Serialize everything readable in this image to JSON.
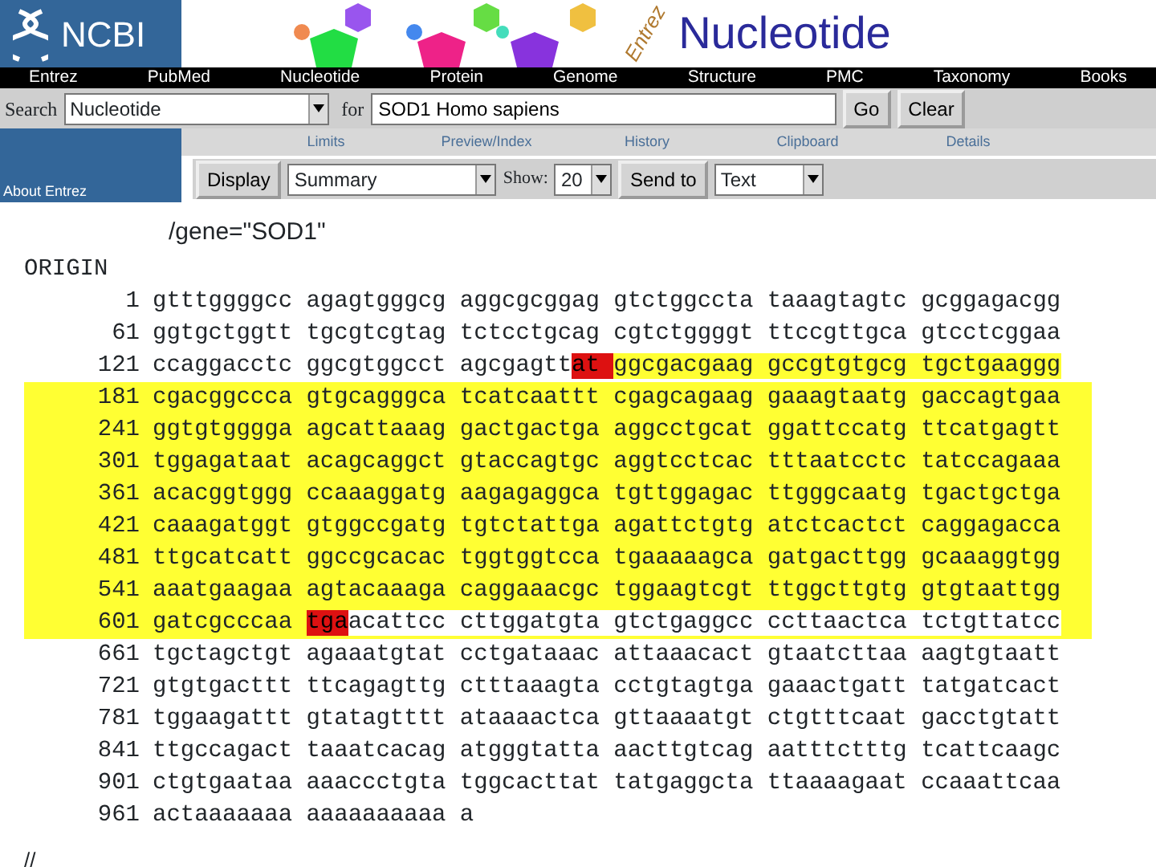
{
  "banner": {
    "org": "NCBI",
    "product_tag": "Entrez",
    "product": "Nucleotide"
  },
  "nav": [
    "Entrez",
    "PubMed",
    "Nucleotide",
    "Protein",
    "Genome",
    "Structure",
    "PMC",
    "Taxonomy",
    "Books"
  ],
  "search": {
    "label": "Search",
    "database": "Nucleotide",
    "for_label": "for",
    "query": "SOD1 Homo sapiens",
    "buttons": [
      "Go",
      "Clear"
    ]
  },
  "sidebar": {
    "link": "About Entrez"
  },
  "links": [
    "Limits",
    "Preview/Index",
    "History",
    "Clipboard",
    "Details"
  ],
  "display_bar": {
    "display_button": "Display",
    "format": "Summary",
    "show_label": "Show:",
    "count": "20",
    "send_button": "Send to",
    "destination": "Text"
  },
  "record": {
    "qualifier": "/gene=\"SOD1\"",
    "origin_label": "ORIGIN",
    "terminator": "//",
    "rows": [
      {
        "number": "1",
        "band": false,
        "segments": [
          {
            "kind": "plain",
            "text": "gtttggggcc agagtgggcg aggcgcggag gtctggccta taaagtagtc gcggagacgg"
          }
        ]
      },
      {
        "number": "61",
        "band": false,
        "segments": [
          {
            "kind": "plain",
            "text": "ggtgctggtt tgcgtcgtag tctcctgcag cgtctggggt ttccgttgca gtcctcggaa"
          }
        ]
      },
      {
        "number": "121",
        "band": false,
        "segments": [
          {
            "kind": "plain",
            "text": "ccaggacctc ggcgtggcct agcgagtt"
          },
          {
            "kind": "start",
            "text": "at "
          },
          {
            "kind": "cds",
            "text": "ggcgacgaag gccgtgtgcg tgctgaaggg"
          }
        ]
      },
      {
        "number": "181",
        "band": true,
        "segments": [
          {
            "kind": "cds",
            "text": "cgacggccca gtgcagggca tcatcaattt cgagcagaag gaaagtaatg gaccagtgaa"
          }
        ]
      },
      {
        "number": "241",
        "band": true,
        "segments": [
          {
            "kind": "cds",
            "text": "ggtgtgggga agcattaaag gactgactga aggcctgcat ggattccatg ttcatgagtt"
          }
        ]
      },
      {
        "number": "301",
        "band": true,
        "segments": [
          {
            "kind": "cds",
            "text": "tggagataat acagcaggct gtaccagtgc aggtcctcac tttaatcctc tatccagaaa"
          }
        ]
      },
      {
        "number": "361",
        "band": true,
        "segments": [
          {
            "kind": "cds",
            "text": "acacggtggg ccaaaggatg aagagaggca tgttggagac ttgggcaatg tgactgctga"
          }
        ]
      },
      {
        "number": "421",
        "band": true,
        "segments": [
          {
            "kind": "cds",
            "text": "caaagatggt gtggccgatg tgtctattga agattctgtg atctcactct caggagacca"
          }
        ]
      },
      {
        "number": "481",
        "band": true,
        "segments": [
          {
            "kind": "cds",
            "text": "ttgcatcatt ggccgcacac tggtggtcca tgaaaaagca gatgacttgg gcaaaggtgg"
          }
        ]
      },
      {
        "number": "541",
        "band": true,
        "segments": [
          {
            "kind": "cds",
            "text": "aaatgaagaa agtacaaaga caggaaacgc tggaagtcgt ttggcttgtg gtgtaattgg"
          }
        ]
      },
      {
        "number": "601",
        "band": true,
        "segments": [
          {
            "kind": "cds",
            "text": "gatcgcccaa "
          },
          {
            "kind": "stop",
            "text": "tga"
          },
          {
            "kind": "plain",
            "text": "acattcc cttggatgta gtctgaggcc ccttaactca tctgttatcc"
          }
        ]
      },
      {
        "number": "661",
        "band": false,
        "segments": [
          {
            "kind": "plain",
            "text": "tgctagctgt agaaatgtat cctgataaac attaaacact gtaatcttaa aagtgtaatt"
          }
        ]
      },
      {
        "number": "721",
        "band": false,
        "segments": [
          {
            "kind": "plain",
            "text": "gtgtgacttt ttcagagttg ctttaaagta cctgtagtga gaaactgatt tatgatcact"
          }
        ]
      },
      {
        "number": "781",
        "band": false,
        "segments": [
          {
            "kind": "plain",
            "text": "tggaagattt gtatagtttt ataaaactca gttaaaatgt ctgtttcaat gacctgtatt"
          }
        ]
      },
      {
        "number": "841",
        "band": false,
        "segments": [
          {
            "kind": "plain",
            "text": "ttgccagact taaatcacag atgggtatta aacttgtcag aatttctttg tcattcaagc"
          }
        ]
      },
      {
        "number": "901",
        "band": false,
        "segments": [
          {
            "kind": "plain",
            "text": "ctgtgaataa aaaccctgta tggcacttat tatgaggcta ttaaaagaat ccaaattcaa"
          }
        ]
      },
      {
        "number": "961",
        "band": false,
        "segments": [
          {
            "kind": "plain",
            "text": "actaaaaaaa aaaaaaaaaa a"
          }
        ]
      }
    ]
  }
}
